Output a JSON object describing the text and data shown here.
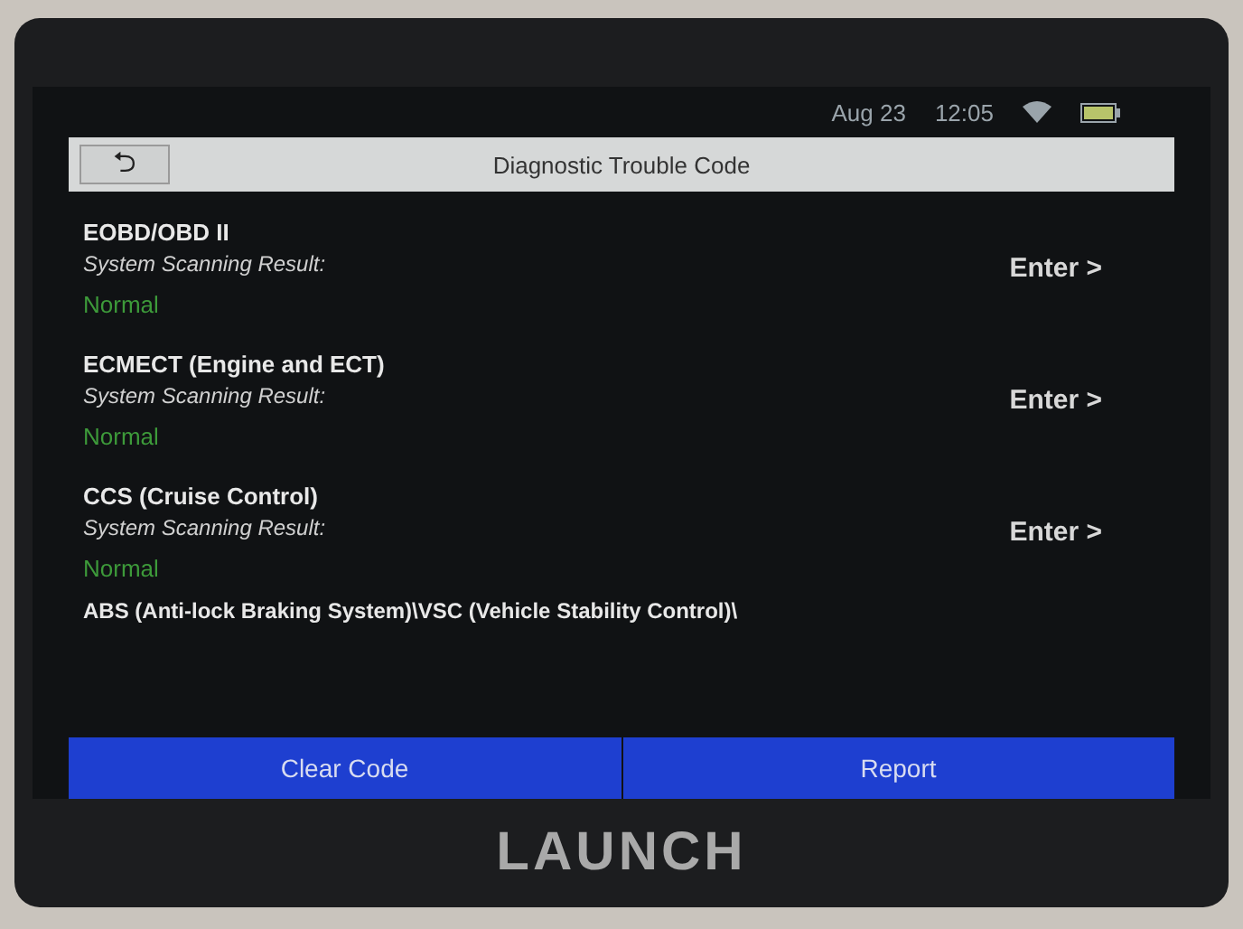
{
  "status_bar": {
    "date": "Aug 23",
    "time": "12:05"
  },
  "header": {
    "back": "⮌",
    "title": "Diagnostic Trouble Code"
  },
  "systems": [
    {
      "name": "EOBD/OBD II",
      "label": "System Scanning Result:",
      "result": "Normal",
      "action": "Enter >"
    },
    {
      "name": "ECMECT (Engine and ECT)",
      "label": "System Scanning Result:",
      "result": "Normal",
      "action": "Enter >"
    },
    {
      "name": "CCS (Cruise Control)",
      "label": "System Scanning Result:",
      "result": "Normal",
      "action": "Enter >"
    },
    {
      "name": "ABS (Anti-lock Braking System)\\VSC (Vehicle Stability Control)\\"
    }
  ],
  "buttons": [
    "Clear Code",
    "Report"
  ],
  "brand": "LAUNCH"
}
